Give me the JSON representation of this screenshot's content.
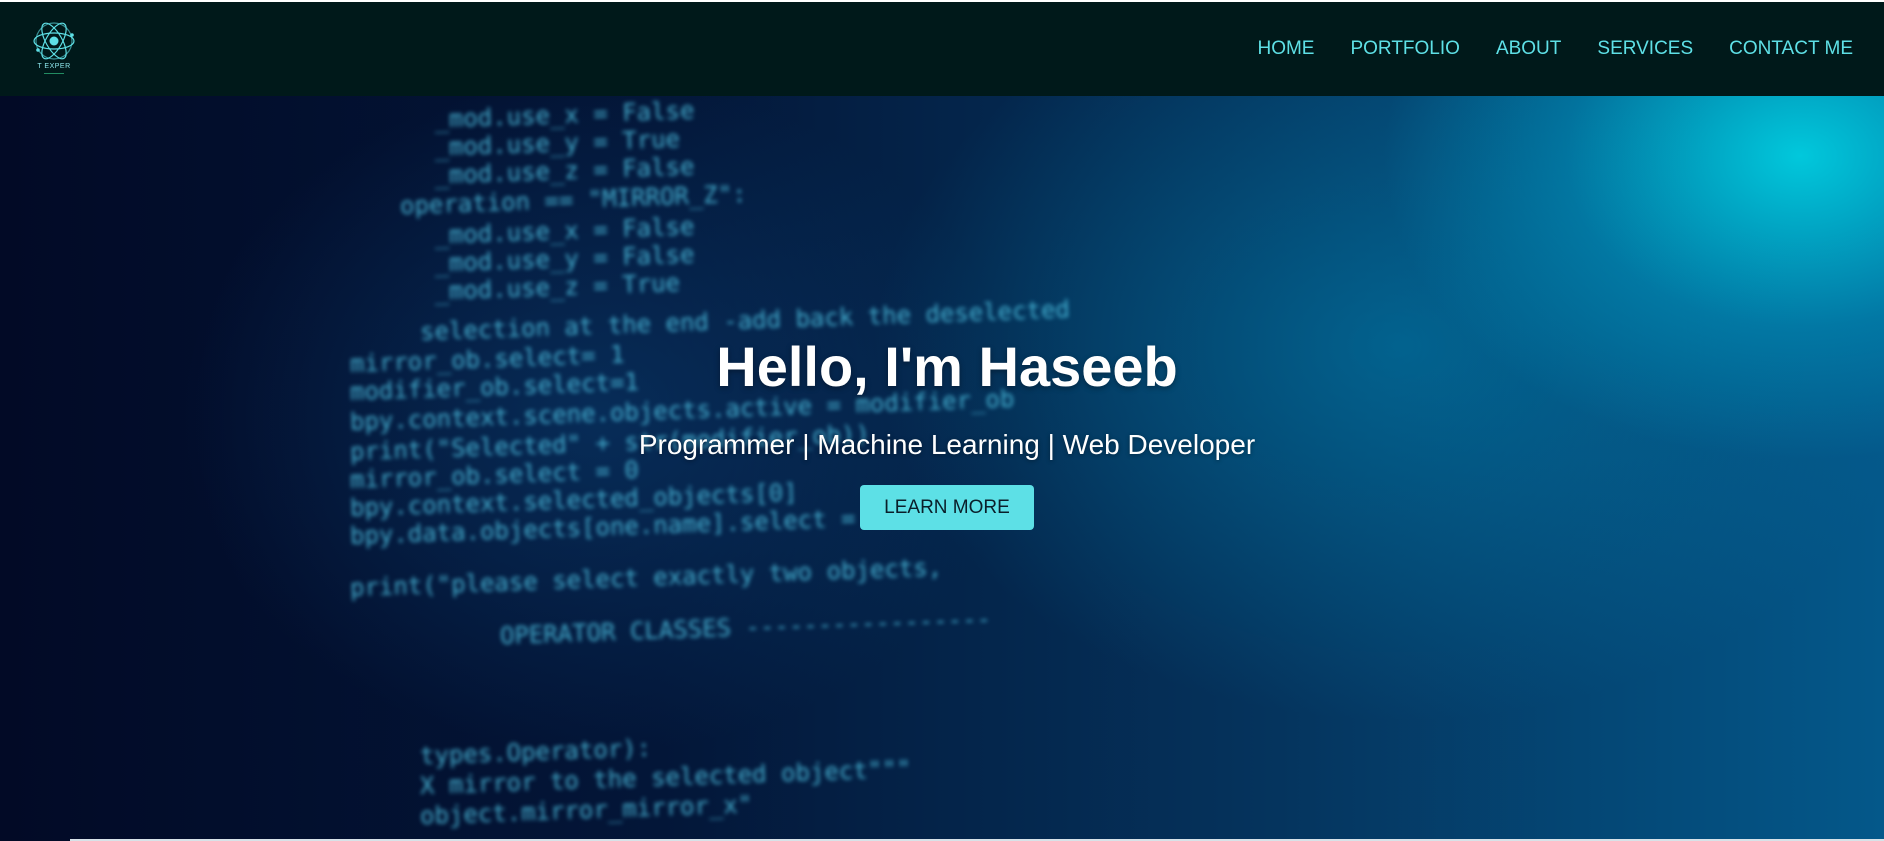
{
  "header": {
    "logo": {
      "icon": "atom-icon",
      "text": "T EXPER",
      "accent_color": "#5ee0e6"
    },
    "nav": [
      {
        "label": "HOME"
      },
      {
        "label": "PORTFOLIO"
      },
      {
        "label": "ABOUT"
      },
      {
        "label": "SERVICES"
      },
      {
        "label": "CONTACT ME"
      }
    ],
    "background_color": "#00191a",
    "link_color": "#5ee0e6"
  },
  "hero": {
    "title": "Hello, I'm Haseeb",
    "subtitle": "Programmer | Machine Learning | Web Developer",
    "cta_label": "LEARN MORE",
    "cta_color": "#5de0e6",
    "background_image": "blurred-code-background"
  }
}
